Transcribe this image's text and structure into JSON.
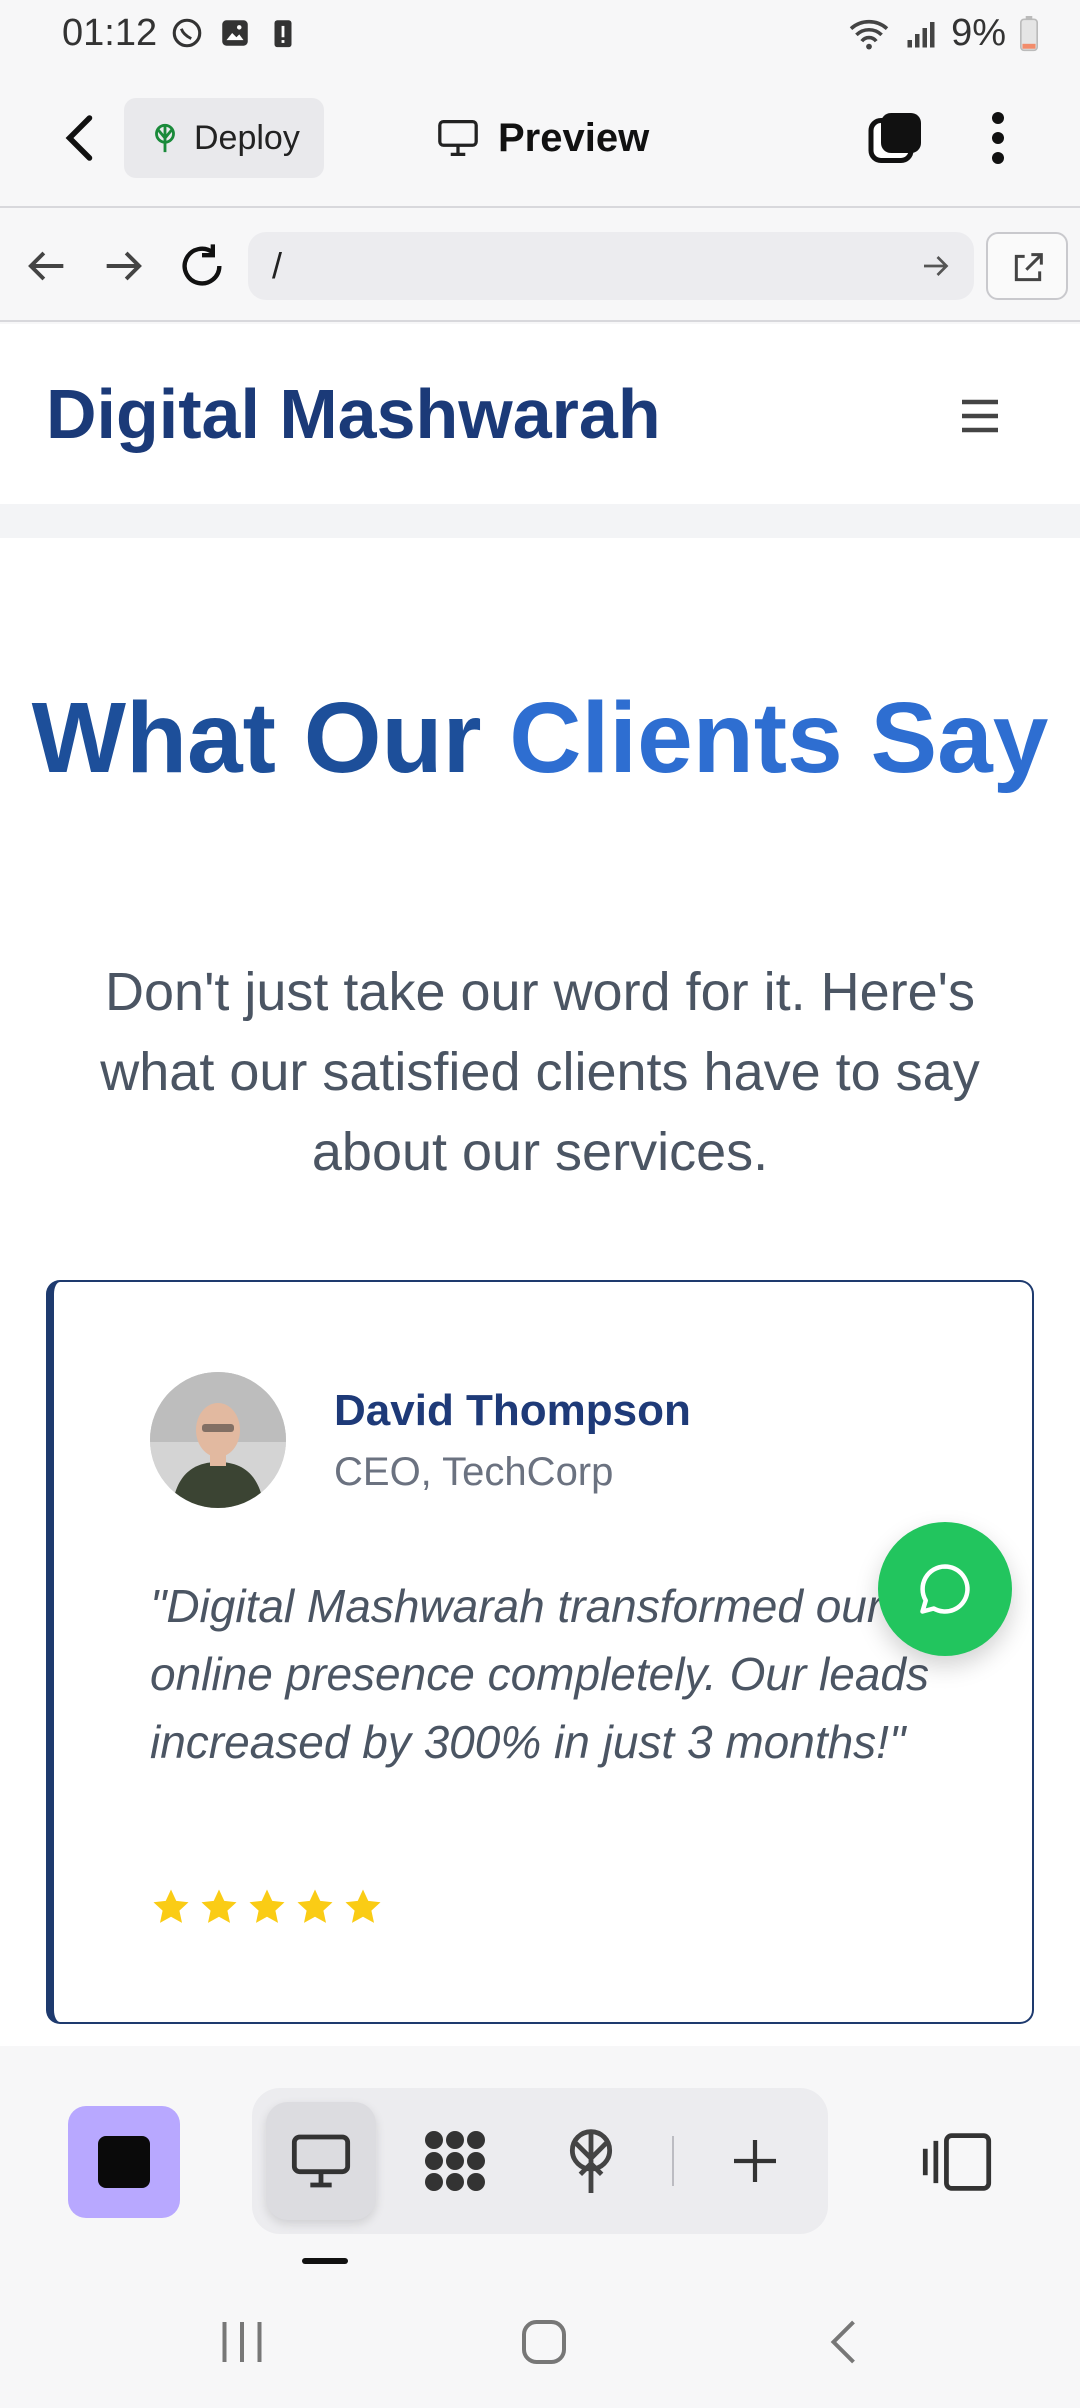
{
  "status_bar": {
    "time": "01:12",
    "battery": "9%",
    "icons": [
      "whatsapp-icon",
      "gallery-icon",
      "battery-alert-icon",
      "wifi-icon",
      "signal-icon",
      "battery-icon"
    ]
  },
  "app_bar": {
    "deploy_label": "Deploy",
    "preview_label": "Preview"
  },
  "browser": {
    "url": "/"
  },
  "site": {
    "logo": "Digital Mashwarah",
    "heading_part1": "What Our ",
    "heading_part2": "Clients Say",
    "subtitle": "Don't just take our word for it. Here's what our satisfied clients have to say about our services.",
    "testimonial": {
      "name": "David Thompson",
      "role": "CEO, TechCorp",
      "quote": "\"Digital Mashwarah transformed our online presence completely. Our leads increased by 300% in just 3 months!\"",
      "rating": 5,
      "rating_max": 5
    }
  },
  "colors": {
    "brand_navy": "#1b3a78",
    "heading_blue": "#2e6ed1",
    "star_yellow": "#facc15",
    "whatsapp_green": "#22c55e",
    "stop_button_purple": "#b8a8ff"
  }
}
